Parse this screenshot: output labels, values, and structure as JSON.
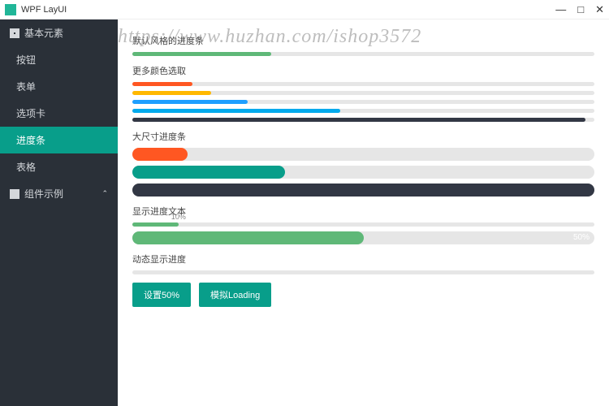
{
  "window": {
    "title": "WPF LayUI",
    "minimize": "—",
    "maximize": "□",
    "close": "✕"
  },
  "watermark": "https://www.huzhan.com/ishop3572",
  "sidebar": {
    "group1": {
      "label": "基本元素"
    },
    "items1": [
      {
        "label": "按钮"
      },
      {
        "label": "表单"
      },
      {
        "label": "选项卡"
      },
      {
        "label": "进度条"
      },
      {
        "label": "表格"
      }
    ],
    "group2": {
      "label": "组件示例"
    }
  },
  "sections": {
    "s0": "默认风格的进度条",
    "s1": "更多颜色选取",
    "s2": "大尺寸进度条",
    "s3": "显示进度文本",
    "s4": "动态显示进度"
  },
  "bars_default": [
    {
      "pct": 30,
      "color": "#5fb878"
    }
  ],
  "bars_colors": [
    {
      "pct": 13,
      "color": "#ff5722"
    },
    {
      "pct": 17,
      "color": "#ffb800"
    },
    {
      "pct": 25,
      "color": "#1e9fff"
    },
    {
      "pct": 45,
      "color": "#01aaed"
    },
    {
      "pct": 98,
      "color": "#323744"
    }
  ],
  "bars_big": [
    {
      "pct": 12,
      "color": "#ff5722"
    },
    {
      "pct": 33,
      "color": "#089e8a"
    },
    {
      "pct": 100,
      "color": "#323744"
    }
  ],
  "bars_text": [
    {
      "pct": 10,
      "color": "#5fb878",
      "label": "10%",
      "inside": false
    },
    {
      "pct": 50,
      "color": "#5fb878",
      "label": "50%",
      "inside": true
    }
  ],
  "bars_dynamic": [
    {
      "pct": 0,
      "color": "#5fb878"
    }
  ],
  "buttons": {
    "set50": "设置50%",
    "loading": "模拟Loading"
  }
}
